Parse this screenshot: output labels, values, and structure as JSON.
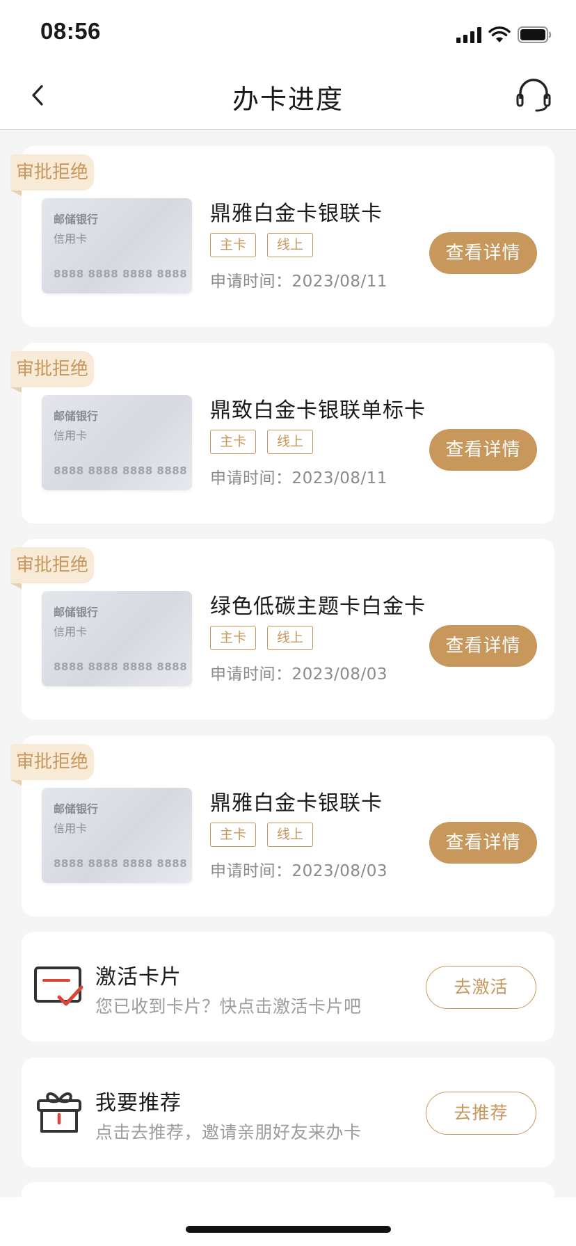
{
  "status_bar": {
    "time": "08:56"
  },
  "header": {
    "title": "办卡进度"
  },
  "applications": [
    {
      "status": "审批拒绝",
      "card_bank": "邮储银行",
      "card_type": "信用卡",
      "card_number": "8888 8888 8888 8888",
      "product_name": "鼎雅白金卡银联卡",
      "tags": [
        "主卡",
        "线上"
      ],
      "apply_time": "申请时间：2023/08/11",
      "detail_label": "查看详情"
    },
    {
      "status": "审批拒绝",
      "card_bank": "邮储银行",
      "card_type": "信用卡",
      "card_number": "8888 8888 8888 8888",
      "product_name": "鼎致白金卡银联单标卡",
      "tags": [
        "主卡",
        "线上"
      ],
      "apply_time": "申请时间：2023/08/11",
      "detail_label": "查看详情"
    },
    {
      "status": "审批拒绝",
      "card_bank": "邮储银行",
      "card_type": "信用卡",
      "card_number": "8888 8888 8888 8888",
      "product_name": "绿色低碳主题卡白金卡",
      "tags": [
        "主卡",
        "线上"
      ],
      "apply_time": "申请时间：2023/08/03",
      "detail_label": "查看详情"
    },
    {
      "status": "审批拒绝",
      "card_bank": "邮储银行",
      "card_type": "信用卡",
      "card_number": "8888 8888 8888 8888",
      "product_name": "鼎雅白金卡银联卡",
      "tags": [
        "主卡",
        "线上"
      ],
      "apply_time": "申请时间：2023/08/03",
      "detail_label": "查看详情"
    }
  ],
  "activate": {
    "icon": "card-check-icon",
    "title": "激活卡片",
    "desc": "您已收到卡片？快点击激活卡片吧",
    "button": "去激活"
  },
  "recommend": {
    "icon": "gift-icon",
    "title": "我要推荐",
    "desc": "点击去推荐，邀请亲朋好友来办卡",
    "button": "去推荐"
  },
  "colors": {
    "accent": "#c8975c",
    "badge_bg": "#f7ead7",
    "page_bg": "#f5f5f5",
    "icon_red": "#d9453b"
  }
}
